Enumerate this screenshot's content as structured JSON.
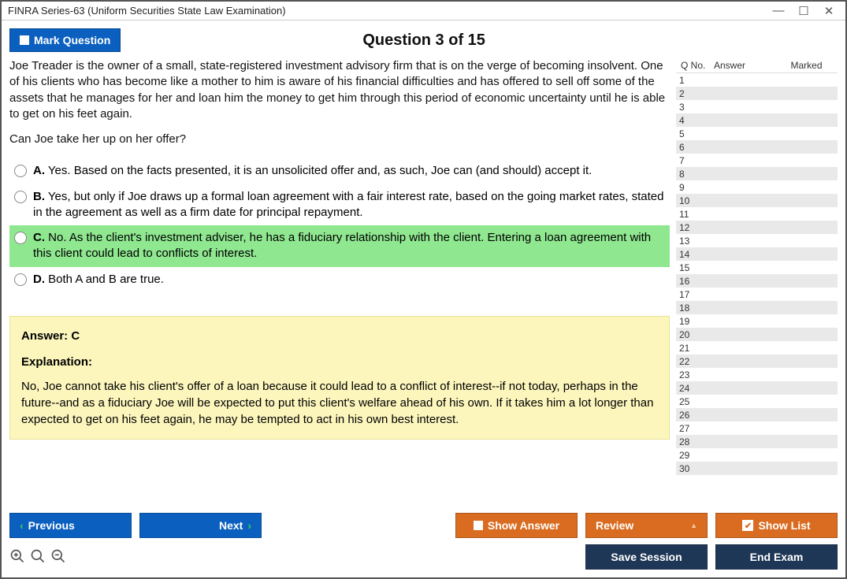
{
  "window": {
    "title": "FINRA Series-63 (Uniform Securities State Law Examination)"
  },
  "header": {
    "mark_label": "Mark Question",
    "question_title": "Question 3 of 15"
  },
  "question": {
    "para1": "Joe Treader is the owner of a small, state-registered investment advisory firm that is on the verge of becoming insolvent. One of his clients who has become like a mother to him is aware of his financial difficulties and has offered to sell off some of the assets that he manages for her and loan him the money to get him through this period of economic uncertainty until he is able to get on his feet again.",
    "para2": "Can Joe take her up on her offer?"
  },
  "options": {
    "a": {
      "letter": "A.",
      "text": "Yes. Based on the facts presented, it is an unsolicited offer and, as such, Joe can (and should) accept it."
    },
    "b": {
      "letter": "B.",
      "text": "Yes, but only if Joe draws up a formal loan agreement with a fair interest rate, based on the going market rates, stated in the agreement as well as a firm date for principal repayment."
    },
    "c": {
      "letter": "C.",
      "text": "No. As the client's investment adviser, he has a fiduciary relationship with the client. Entering a loan agreement with this client could lead to conflicts of interest."
    },
    "d": {
      "letter": "D.",
      "text": "Both A and B are true."
    }
  },
  "answer": {
    "line": "Answer: C",
    "exp_label": "Explanation:",
    "exp_text": "No, Joe cannot take his client's offer of a loan because it could lead to a conflict of interest--if not today, perhaps in the future--and as a fiduciary Joe will be expected to put this client's welfare ahead of his own. If it takes him a lot longer than expected to get on his feet again, he may be tempted to act in his own best interest."
  },
  "qlist": {
    "h_qno": "Q No.",
    "h_answer": "Answer",
    "h_marked": "Marked",
    "count": 30
  },
  "buttons": {
    "previous": "Previous",
    "next": "Next",
    "show_answer": "Show Answer",
    "review": "Review",
    "show_list": "Show List",
    "save_session": "Save Session",
    "end_exam": "End Exam"
  }
}
